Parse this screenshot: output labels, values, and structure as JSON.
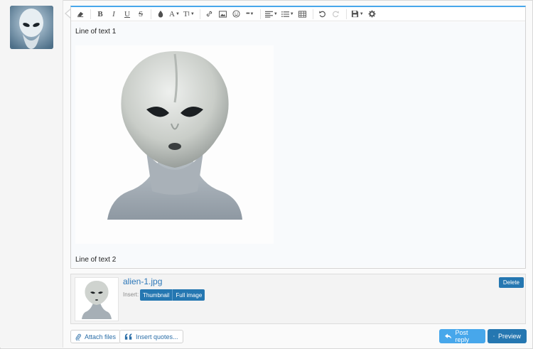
{
  "editor": {
    "toolbar": {
      "bold": "B",
      "italic": "I",
      "underline": "U",
      "strike": "S",
      "font_size": "T",
      "font_color": "A",
      "more": "•••"
    },
    "content": {
      "line1": "Line of text 1",
      "line2": "Line of text 2"
    }
  },
  "attachment": {
    "filename": "alien-1.jpg",
    "insert_label": "Insert:",
    "thumbnail_button": "Thumbnail",
    "full_image_button": "Full image",
    "delete_button": "Delete"
  },
  "footer": {
    "attach_files": "Attach files",
    "insert_quotes": "Insert quotes...",
    "post_reply": "Post reply",
    "preview": "Preview"
  },
  "colors": {
    "accent": "#47a7eb",
    "primary_button": "#2577b1",
    "link": "#2c77b8"
  }
}
